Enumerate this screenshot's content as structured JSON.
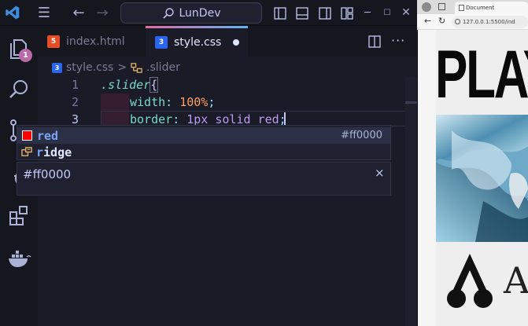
{
  "titlebar": {
    "search_text": "LunDev"
  },
  "activity_bar": {
    "explorer_badge": "1"
  },
  "tabs": [
    {
      "label": "index.html",
      "icon_text": "5",
      "icon_color": "#e44d26"
    },
    {
      "label": "style.css",
      "icon_text": "3",
      "icon_color": "#2965f1"
    }
  ],
  "breadcrumb": {
    "file": "style.css",
    "separator": ">",
    "symbol": ".slider"
  },
  "editor": {
    "line_numbers": [
      "1",
      "2",
      "3"
    ],
    "lines": {
      "l1_selector": ".slider",
      "l1_brace": "{",
      "l2_prop": "width",
      "l2_colon": ":",
      "l2_value": "100%",
      "l2_semicolon": ";",
      "l3_prop": "border",
      "l3_colon": ":",
      "l3_value": "1px solid red",
      "l3_semicolon": ";"
    }
  },
  "suggest": {
    "items": [
      {
        "label": "red",
        "match": "red",
        "rest": "",
        "detail": "#ff0000"
      },
      {
        "label": "ridge",
        "match": "r",
        "rest": "idge"
      }
    ],
    "details_text": "#ff0000",
    "close_glyph": "×"
  },
  "browser": {
    "tab_title": "Document",
    "url": "127.0.0.1:5500/ind",
    "headline": "PLAY",
    "letter": "A"
  },
  "colors": {
    "editor_bg": "#1a1b26",
    "sidebar_bg": "#16161e",
    "keyword": "#bb9af7",
    "property": "#73daca",
    "selector": "#7dcfff",
    "swatch": "#ff0000"
  }
}
